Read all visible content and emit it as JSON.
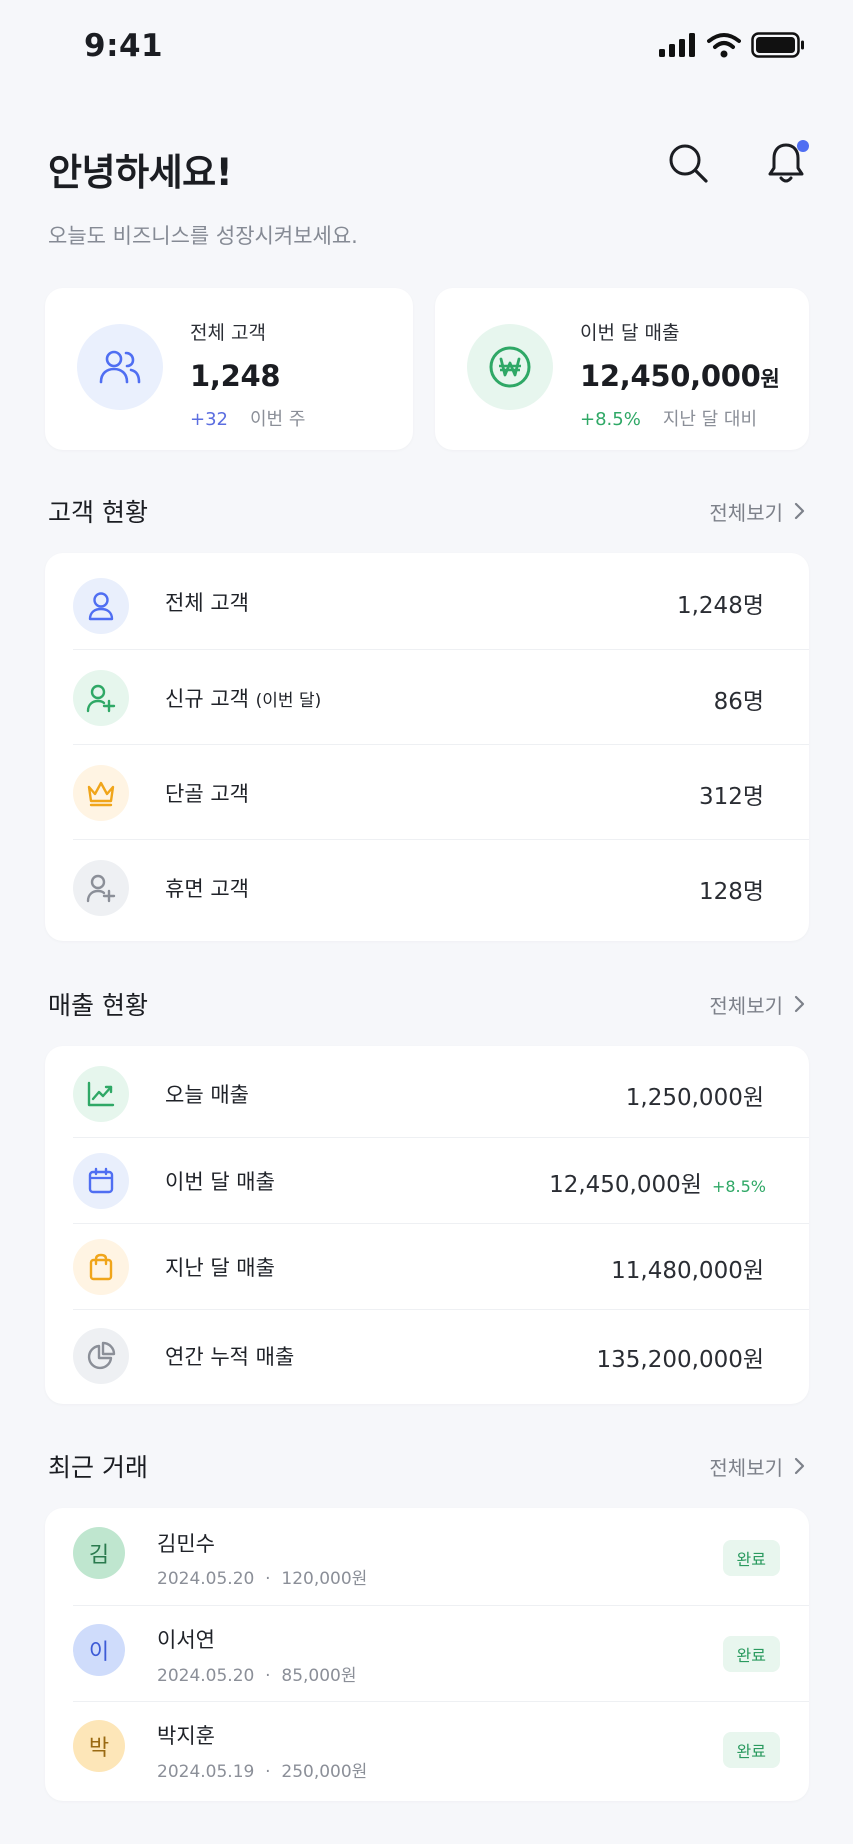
{
  "status_bar": {
    "time": "9:41"
  },
  "greeting": {
    "title": "안녕하세요!",
    "subtitle": "오늘도 비즈니스를 성장시켜보세요."
  },
  "header": {
    "icons": [
      "search-icon",
      "bell-icon"
    ],
    "notification_dot_color": "#4f6ef2"
  },
  "summary": [
    {
      "label": "전체 고객",
      "value": "1,248",
      "unit": "",
      "delta": "+32",
      "delta_color": "#5b6ee0",
      "note": "이번 주",
      "icon": "users-icon",
      "icon_bg": "#eaf0fd",
      "icon_color": "#4f6ef2"
    },
    {
      "label": "이번 달 매출",
      "value": "12,450,000",
      "unit": "원",
      "delta": "+8.5%",
      "delta_color": "#2fa866",
      "note": "지난 달 대비",
      "icon": "won-icon",
      "icon_bg": "#e7f6ee",
      "icon_color": "#2fa866"
    }
  ],
  "customer_section": {
    "title": "고객 현황",
    "see_all": "전체보기",
    "rows": [
      {
        "label": "전체 고객",
        "label_small": "",
        "value": "1,248명",
        "icon": "user-icon",
        "icon_bg": "#e9effc",
        "icon_color": "#4f6ef2"
      },
      {
        "label": "신규 고객",
        "label_small": "(이번 달)",
        "value": "86명",
        "icon": "user-plus-icon",
        "icon_bg": "#e6f6ed",
        "icon_color": "#2fa866"
      },
      {
        "label": "단골 고객",
        "label_small": "",
        "value": "312명",
        "icon": "crown-icon",
        "icon_bg": "#fff4e3",
        "icon_color": "#f0a51a"
      },
      {
        "label": "휴면 고객",
        "label_small": "",
        "value": "128명",
        "icon": "user-plus-gray-icon",
        "icon_bg": "#eef0f3",
        "icon_color": "#8b8f98"
      }
    ]
  },
  "sales_section": {
    "title": "매출 현황",
    "see_all": "전체보기",
    "rows": [
      {
        "label": "오늘 매출",
        "value": "1,250,000원",
        "delta": "",
        "icon": "chart-line-icon",
        "icon_bg": "#e6f6ed",
        "icon_color": "#2fa866"
      },
      {
        "label": "이번 달 매출",
        "value": "12,450,000원",
        "delta": "+8.5%",
        "icon": "calendar-icon",
        "icon_bg": "#e9effc",
        "icon_color": "#4f6ef2"
      },
      {
        "label": "지난 달 매출",
        "value": "11,480,000원",
        "delta": "",
        "icon": "shopping-bag-icon",
        "icon_bg": "#fff4e3",
        "icon_color": "#f0a51a"
      },
      {
        "label": "연간 누적 매출",
        "value": "135,200,000원",
        "delta": "",
        "icon": "pie-chart-icon",
        "icon_bg": "#eef0f3",
        "icon_color": "#8b8f98"
      }
    ]
  },
  "transactions_section": {
    "title": "최근 거래",
    "see_all": "전체보기",
    "rows": [
      {
        "initial": "김",
        "name": "김민수",
        "date": "2024.05.20",
        "amount": "120,000원",
        "status": "완료",
        "avatar_bg": "#bfe6cf",
        "avatar_color": "#2a7a4e"
      },
      {
        "initial": "이",
        "name": "이서연",
        "date": "2024.05.20",
        "amount": "85,000원",
        "status": "완료",
        "avatar_bg": "#cfdcfb",
        "avatar_color": "#3d5bd6"
      },
      {
        "initial": "박",
        "name": "박지훈",
        "date": "2024.05.19",
        "amount": "250,000원",
        "status": "완료",
        "avatar_bg": "#fde6b8",
        "avatar_color": "#9a6a12"
      }
    ]
  }
}
